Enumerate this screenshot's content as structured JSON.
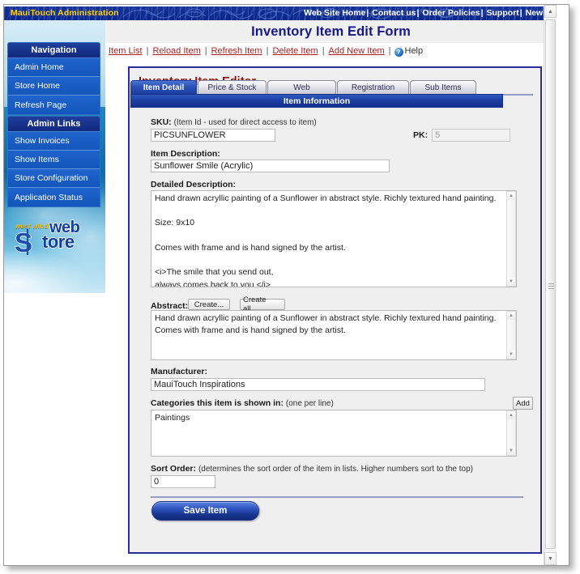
{
  "banner": {
    "title": "MauiTouch Administration",
    "links": [
      "Web Site Home",
      "Contact us",
      "Order Policies",
      "Support",
      "News"
    ]
  },
  "sidebar": {
    "groups": [
      {
        "header": "Navigation",
        "items": [
          {
            "label": "Admin Home"
          },
          {
            "label": "Store Home"
          },
          {
            "label": "Refresh Page"
          }
        ]
      },
      {
        "header": "Admin Links",
        "items": [
          {
            "label": "Show Invoices"
          },
          {
            "label": "Show Items"
          },
          {
            "label": "Store Configuration"
          },
          {
            "label": "Application Status"
          }
        ]
      }
    ],
    "logo": {
      "westwind": "west wind",
      "web": "web",
      "tore": "tore"
    }
  },
  "page": {
    "title": "Inventory Item Edit Form"
  },
  "toolbar": {
    "links": [
      "Item List",
      "Reload Item",
      "Refresh Item",
      "Delete Item",
      "Add New Item"
    ],
    "help_label": "Help",
    "help_icon_glyph": "?"
  },
  "editor": {
    "title": "Inventory Item Editor",
    "tabs": [
      {
        "label": "Item Detail",
        "active": true
      },
      {
        "label": "Price & Stock",
        "active": false
      },
      {
        "label": "Web",
        "active": false
      },
      {
        "label": "Registration",
        "active": false
      },
      {
        "label": "Sub Items",
        "active": false
      }
    ],
    "section_header": "Item Information",
    "fields": {
      "sku": {
        "label": "SKU:",
        "hint": "(Item Id - used for direct access to item)",
        "value": "PICSUNFLOWER"
      },
      "pk": {
        "label": "PK:",
        "value": "5",
        "disabled": true
      },
      "item_description": {
        "label": "Item Description:",
        "value": "Sunflower Smile (Acrylic)"
      },
      "detailed_description": {
        "label": "Detailed Description:",
        "value": "Hand drawn acryllic painting of a Sunflower in abstract style. Richly textured hand painting.\n\nSize: 9x10\n\nComes with frame and is hand signed by the artist.\n\n<i>The smile that you send out,\nalways comes back to you.</i>"
      },
      "abstract": {
        "label": "Abstract:",
        "create_button": "Create...",
        "create_all_button": "Create all...",
        "value": "Hand drawn acryllic painting of a Sunflower in abstract style. Richly textured hand painting.\nComes with frame and is hand signed by the artist."
      },
      "manufacturer": {
        "label": "Manufacturer:",
        "value": "MauiTouch Inspirations"
      },
      "categories": {
        "label": "Categories this item is shown in:",
        "hint": "(one per line)",
        "selected": "Paintings",
        "options": [
          "Paintings"
        ],
        "add_button": "Add",
        "value": "Paintings"
      },
      "sort_order": {
        "label": "Sort Order:",
        "hint": "(determines the sort order of the item in lists. Higher numbers sort to the top)",
        "value": "0"
      }
    },
    "save_button": "Save Item"
  },
  "colors": {
    "banner_blue": "#0f2c93",
    "banner_yellow": "#ffd200",
    "panel_border": "#2b2b9e",
    "editor_title_red": "#8e1212",
    "page_title_blue": "#15188c",
    "link_red": "#b02020",
    "tab_active_blue": "#1b3ea0",
    "panel_bg": "#efefef"
  }
}
